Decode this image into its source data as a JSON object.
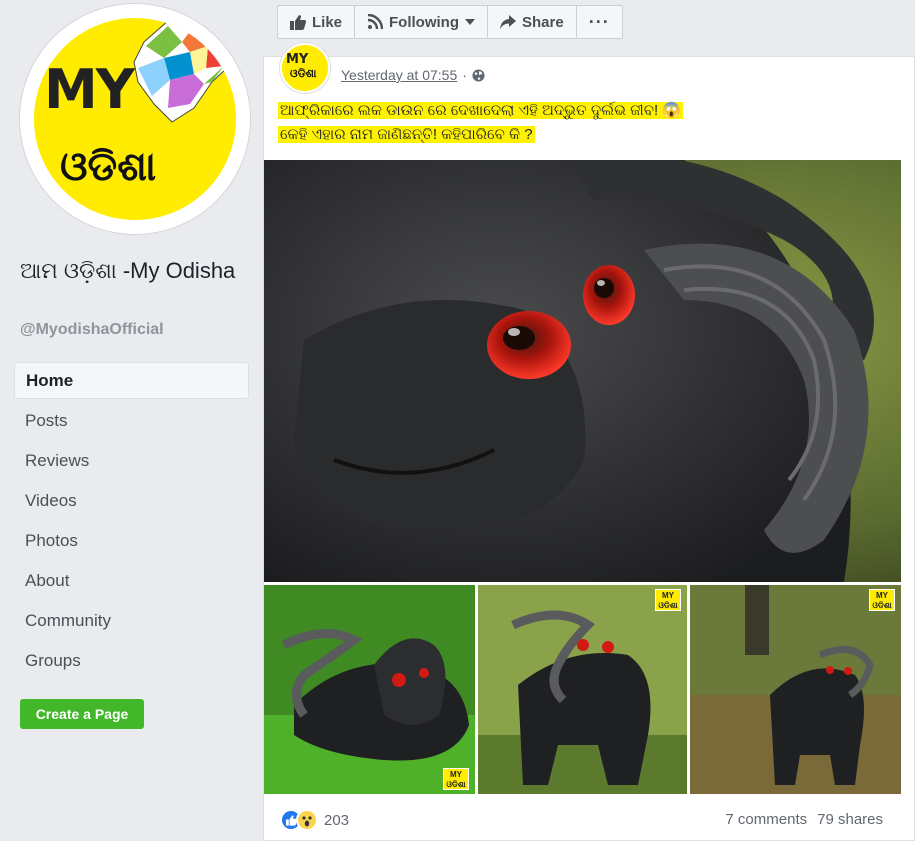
{
  "page": {
    "name": "ଆମ ଓଡ଼ିଶା -My Odisha",
    "handle": "@MyodishaOfficial",
    "logo_text_en": "MY",
    "logo_text_odia": "ଓଡିଶା"
  },
  "nav": {
    "items": [
      {
        "label": "Home",
        "active": true
      },
      {
        "label": "Posts"
      },
      {
        "label": "Reviews"
      },
      {
        "label": "Videos"
      },
      {
        "label": "Photos"
      },
      {
        "label": "About"
      },
      {
        "label": "Community"
      },
      {
        "label": "Groups"
      }
    ],
    "create_page_label": "Create a Page"
  },
  "toolbar": {
    "like_label": "Like",
    "following_label": "Following",
    "share_label": "Share",
    "more_label": "···"
  },
  "post": {
    "timestamp": "Yesterday at 07:55",
    "privacy_icon": "globe-icon",
    "text_line1": "ଆଫ୍ରିକାରେ ଲକ ଡାଉନ ରେ ଦେଖାଦେଲା ଏହି ଅଦ୍ଭୁତ ଦୁର୍ଲଭ ଜୀବ! 😱",
    "text_line2": "କେହି ଏହାର ନାମ ଜାଣିଛନ୍ତି! କହିପାରିବେ କି ?",
    "watermark_my": "MY",
    "watermark_odia": "ଓଡିଶା",
    "reaction_count": "203",
    "comments": "7 comments",
    "shares": "79 shares"
  },
  "colors": {
    "background": "#e9ebee",
    "create_button": "#42b72a",
    "highlight": "#fff200",
    "brand_yellow": "#ffec00",
    "like_blue": "#2078f4"
  }
}
